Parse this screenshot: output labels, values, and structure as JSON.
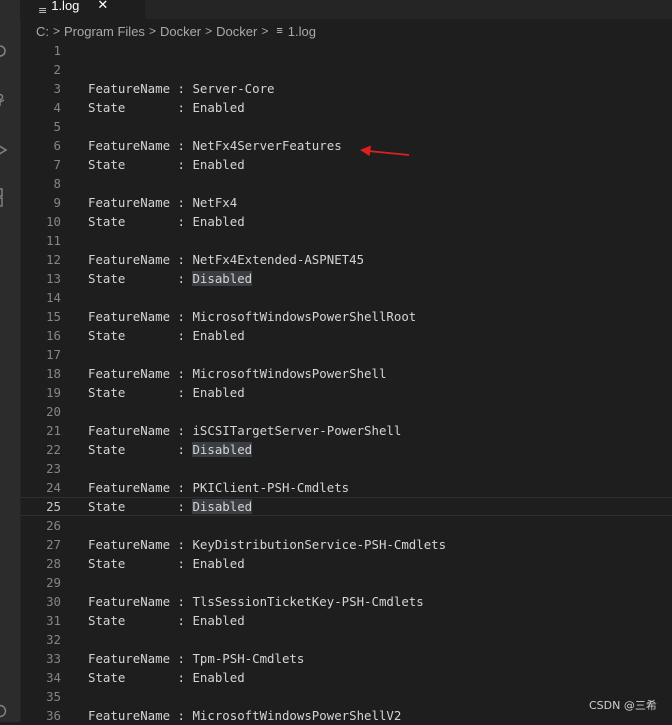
{
  "tab": {
    "label": "1.log",
    "icon": "lines-file-icon",
    "close_glyph": "✕"
  },
  "breadcrumb": {
    "items": [
      "C:",
      "Program Files",
      "Docker",
      "Docker",
      "1.log"
    ],
    "separator": ">"
  },
  "editor": {
    "current_line": 25,
    "lines": [
      {
        "n": "1",
        "key": "",
        "sep": "",
        "value": "",
        "highlight": false
      },
      {
        "n": "2",
        "key": "",
        "sep": "",
        "value": "",
        "highlight": false
      },
      {
        "n": "3",
        "key": "FeatureName",
        "sep": " : ",
        "value": "Server-Core",
        "highlight": false
      },
      {
        "n": "4",
        "key": "State      ",
        "sep": " : ",
        "value": "Enabled",
        "highlight": false
      },
      {
        "n": "5",
        "key": "",
        "sep": "",
        "value": "",
        "highlight": false
      },
      {
        "n": "6",
        "key": "FeatureName",
        "sep": " : ",
        "value": "NetFx4ServerFeatures",
        "highlight": false
      },
      {
        "n": "7",
        "key": "State      ",
        "sep": " : ",
        "value": "Enabled",
        "highlight": false
      },
      {
        "n": "8",
        "key": "",
        "sep": "",
        "value": "",
        "highlight": false
      },
      {
        "n": "9",
        "key": "FeatureName",
        "sep": " : ",
        "value": "NetFx4",
        "highlight": false
      },
      {
        "n": "10",
        "key": "State      ",
        "sep": " : ",
        "value": "Enabled",
        "highlight": false
      },
      {
        "n": "11",
        "key": "",
        "sep": "",
        "value": "",
        "highlight": false
      },
      {
        "n": "12",
        "key": "FeatureName",
        "sep": " : ",
        "value": "NetFx4Extended-ASPNET45",
        "highlight": false
      },
      {
        "n": "13",
        "key": "State      ",
        "sep": " : ",
        "value": "Disabled",
        "highlight": true
      },
      {
        "n": "14",
        "key": "",
        "sep": "",
        "value": "",
        "highlight": false
      },
      {
        "n": "15",
        "key": "FeatureName",
        "sep": " : ",
        "value": "MicrosoftWindowsPowerShellRoot",
        "highlight": false
      },
      {
        "n": "16",
        "key": "State      ",
        "sep": " : ",
        "value": "Enabled",
        "highlight": false
      },
      {
        "n": "17",
        "key": "",
        "sep": "",
        "value": "",
        "highlight": false
      },
      {
        "n": "18",
        "key": "FeatureName",
        "sep": " : ",
        "value": "MicrosoftWindowsPowerShell",
        "highlight": false
      },
      {
        "n": "19",
        "key": "State      ",
        "sep": " : ",
        "value": "Enabled",
        "highlight": false
      },
      {
        "n": "20",
        "key": "",
        "sep": "",
        "value": "",
        "highlight": false
      },
      {
        "n": "21",
        "key": "FeatureName",
        "sep": " : ",
        "value": "iSCSITargetServer-PowerShell",
        "highlight": false
      },
      {
        "n": "22",
        "key": "State      ",
        "sep": " : ",
        "value": "Disabled",
        "highlight": true
      },
      {
        "n": "23",
        "key": "",
        "sep": "",
        "value": "",
        "highlight": false
      },
      {
        "n": "24",
        "key": "FeatureName",
        "sep": " : ",
        "value": "PKIClient-PSH-Cmdlets",
        "highlight": false
      },
      {
        "n": "25",
        "key": "State      ",
        "sep": " : ",
        "value": "Disabled",
        "highlight": true
      },
      {
        "n": "26",
        "key": "",
        "sep": "",
        "value": "",
        "highlight": false
      },
      {
        "n": "27",
        "key": "FeatureName",
        "sep": " : ",
        "value": "KeyDistributionService-PSH-Cmdlets",
        "highlight": false
      },
      {
        "n": "28",
        "key": "State      ",
        "sep": " : ",
        "value": "Enabled",
        "highlight": false
      },
      {
        "n": "29",
        "key": "",
        "sep": "",
        "value": "",
        "highlight": false
      },
      {
        "n": "30",
        "key": "FeatureName",
        "sep": " : ",
        "value": "TlsSessionTicketKey-PSH-Cmdlets",
        "highlight": false
      },
      {
        "n": "31",
        "key": "State      ",
        "sep": " : ",
        "value": "Enabled",
        "highlight": false
      },
      {
        "n": "32",
        "key": "",
        "sep": "",
        "value": "",
        "highlight": false
      },
      {
        "n": "33",
        "key": "FeatureName",
        "sep": " : ",
        "value": "Tpm-PSH-Cmdlets",
        "highlight": false
      },
      {
        "n": "34",
        "key": "State      ",
        "sep": " : ",
        "value": "Enabled",
        "highlight": false
      },
      {
        "n": "35",
        "key": "",
        "sep": "",
        "value": "",
        "highlight": false
      },
      {
        "n": "36",
        "key": "FeatureName",
        "sep": " : ",
        "value": "MicrosoftWindowsPowerShellV2",
        "highlight": false
      }
    ]
  },
  "activity_bar": {
    "icons": [
      "search-icon",
      "source-control-icon",
      "run-debug-icon",
      "extensions-icon",
      "account-icon"
    ]
  },
  "annotation": {
    "arrow_color": "#e02020"
  },
  "watermark": {
    "text": "CSDN @三希"
  },
  "colors": {
    "background": "#1e1e1e",
    "line_number": "#858585",
    "text": "#d4d4d4",
    "selection_highlight": "#3a3d41"
  }
}
